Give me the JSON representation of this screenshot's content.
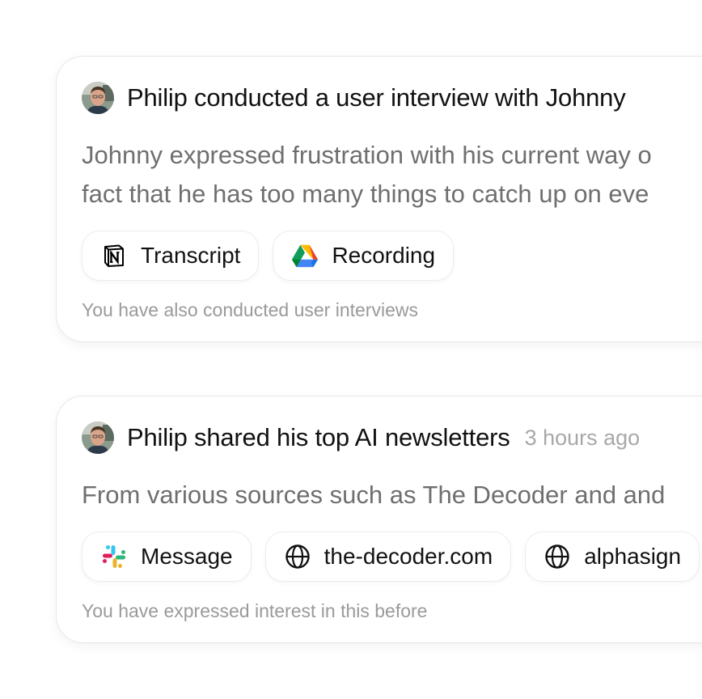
{
  "feed": {
    "items": [
      {
        "title": "Philip conducted a user interview with Johnny",
        "timestamp": "",
        "body_lines": [
          "Johnny expressed frustration with his current way o",
          "fact that he has too many things to catch up on eve"
        ],
        "chips": [
          {
            "icon": "notion-icon",
            "label": "Transcript"
          },
          {
            "icon": "google-drive-icon",
            "label": "Recording"
          }
        ],
        "footnote": "You have also conducted user interviews"
      },
      {
        "title": "Philip shared his top AI newsletters",
        "timestamp": "3 hours ago",
        "body_lines": [
          "From various sources such as The Decoder and and"
        ],
        "chips": [
          {
            "icon": "slack-icon",
            "label": "Message"
          },
          {
            "icon": "globe-icon",
            "label": "the-decoder.com"
          },
          {
            "icon": "globe-icon",
            "label": "alphasign"
          }
        ],
        "footnote": "You have expressed interest in this before"
      }
    ]
  }
}
